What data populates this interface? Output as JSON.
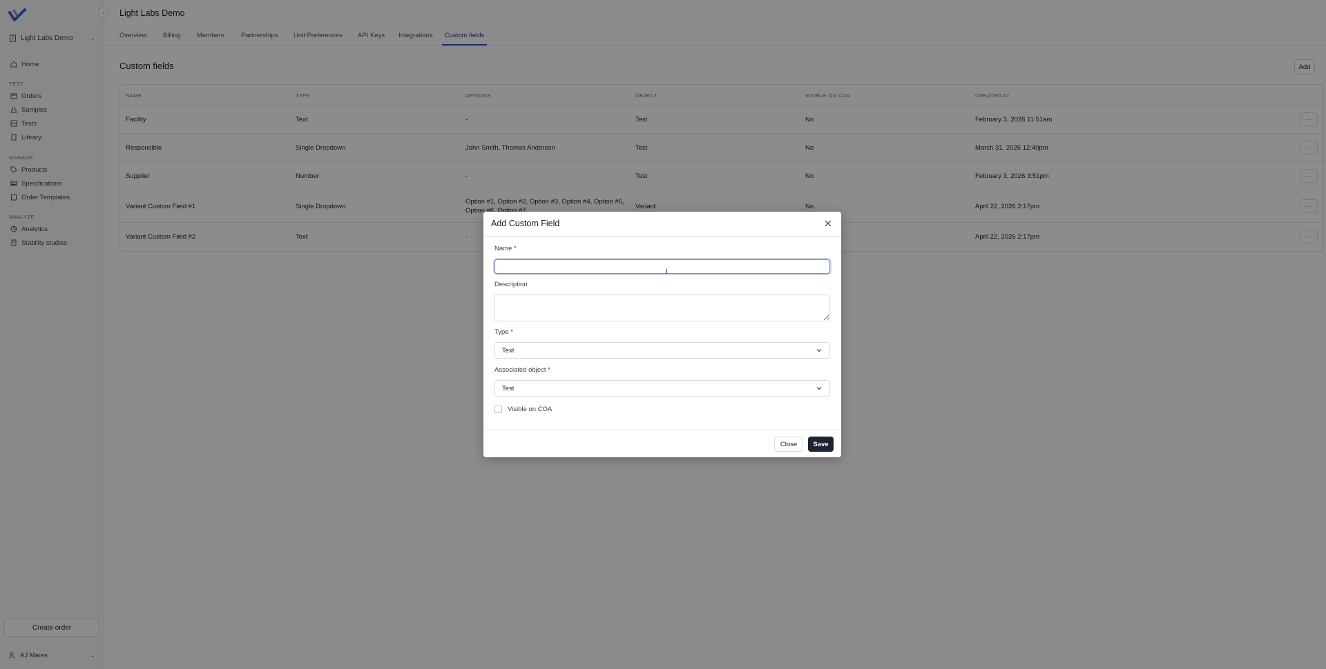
{
  "sidebar": {
    "workspace": "Light Labs Demo",
    "sections": [
      {
        "title": "TEST",
        "items": [
          "Orders",
          "Samples",
          "Tests",
          "Library"
        ]
      },
      {
        "title": "MANAGE",
        "items": [
          "Products",
          "Specifications",
          "Order Templates"
        ]
      },
      {
        "title": "ANALYZE",
        "items": [
          "Analytics",
          "Stability studies"
        ]
      }
    ],
    "home": "Home",
    "create_order": "Create order",
    "user": "AJ Mares"
  },
  "header": {
    "title": "Light Labs Demo",
    "tabs": [
      "Overview",
      "Billing",
      "Members",
      "Partnerships",
      "Unit Preferences",
      "API Keys",
      "Integrations",
      "Custom fields"
    ],
    "active_tab": "Custom fields"
  },
  "content": {
    "heading": "Custom fields",
    "add_label": "Add",
    "columns": [
      "NAME",
      "TYPE",
      "OPTIONS",
      "OBJECT",
      "VISIBLE ON COA",
      "CREATED AT"
    ],
    "rows": [
      {
        "name": "Facility",
        "type": "Text",
        "options": "-",
        "object": "Test",
        "visible": "No",
        "created": "February 3, 2026 11:51am"
      },
      {
        "name": "Responsible",
        "type": "Single Dropdown",
        "options": "John Smith, Thomas Anderson",
        "object": "Test",
        "visible": "No",
        "created": "March 31, 2026 12:40pm"
      },
      {
        "name": "Supplier",
        "type": "Number",
        "options": "-",
        "object": "Test",
        "visible": "No",
        "created": "February 3, 2026 3:51pm"
      },
      {
        "name": "Variant Custom Field #1",
        "type": "Single Dropdown",
        "options": "Option #1, Option #2, Option #3, Option #4, Option #5, Option #6, Option #7",
        "object": "Variant",
        "visible": "No",
        "created": "April 22, 2026 2:17pm"
      },
      {
        "name": "Variant Custom Field #2",
        "type": "Text",
        "options": "-",
        "object": "",
        "visible": "",
        "created": "April 22, 2026 2:17pm"
      }
    ],
    "row_action": "···"
  },
  "modal": {
    "title": "Add Custom Field",
    "name_label": "Name",
    "name_value": "",
    "description_label": "Description",
    "type_label": "Type",
    "type_value": "Text",
    "object_label": "Associated object",
    "object_value": "Test",
    "visible_label": "Visible on COA",
    "visible_checked": false,
    "close_label": "Close",
    "save_label": "Save",
    "required_mark": "*"
  },
  "colors": {
    "accent": "#2b4fc7",
    "primary_button": "#1d2433",
    "overlay": "rgba(0,0,0,0.45)"
  }
}
